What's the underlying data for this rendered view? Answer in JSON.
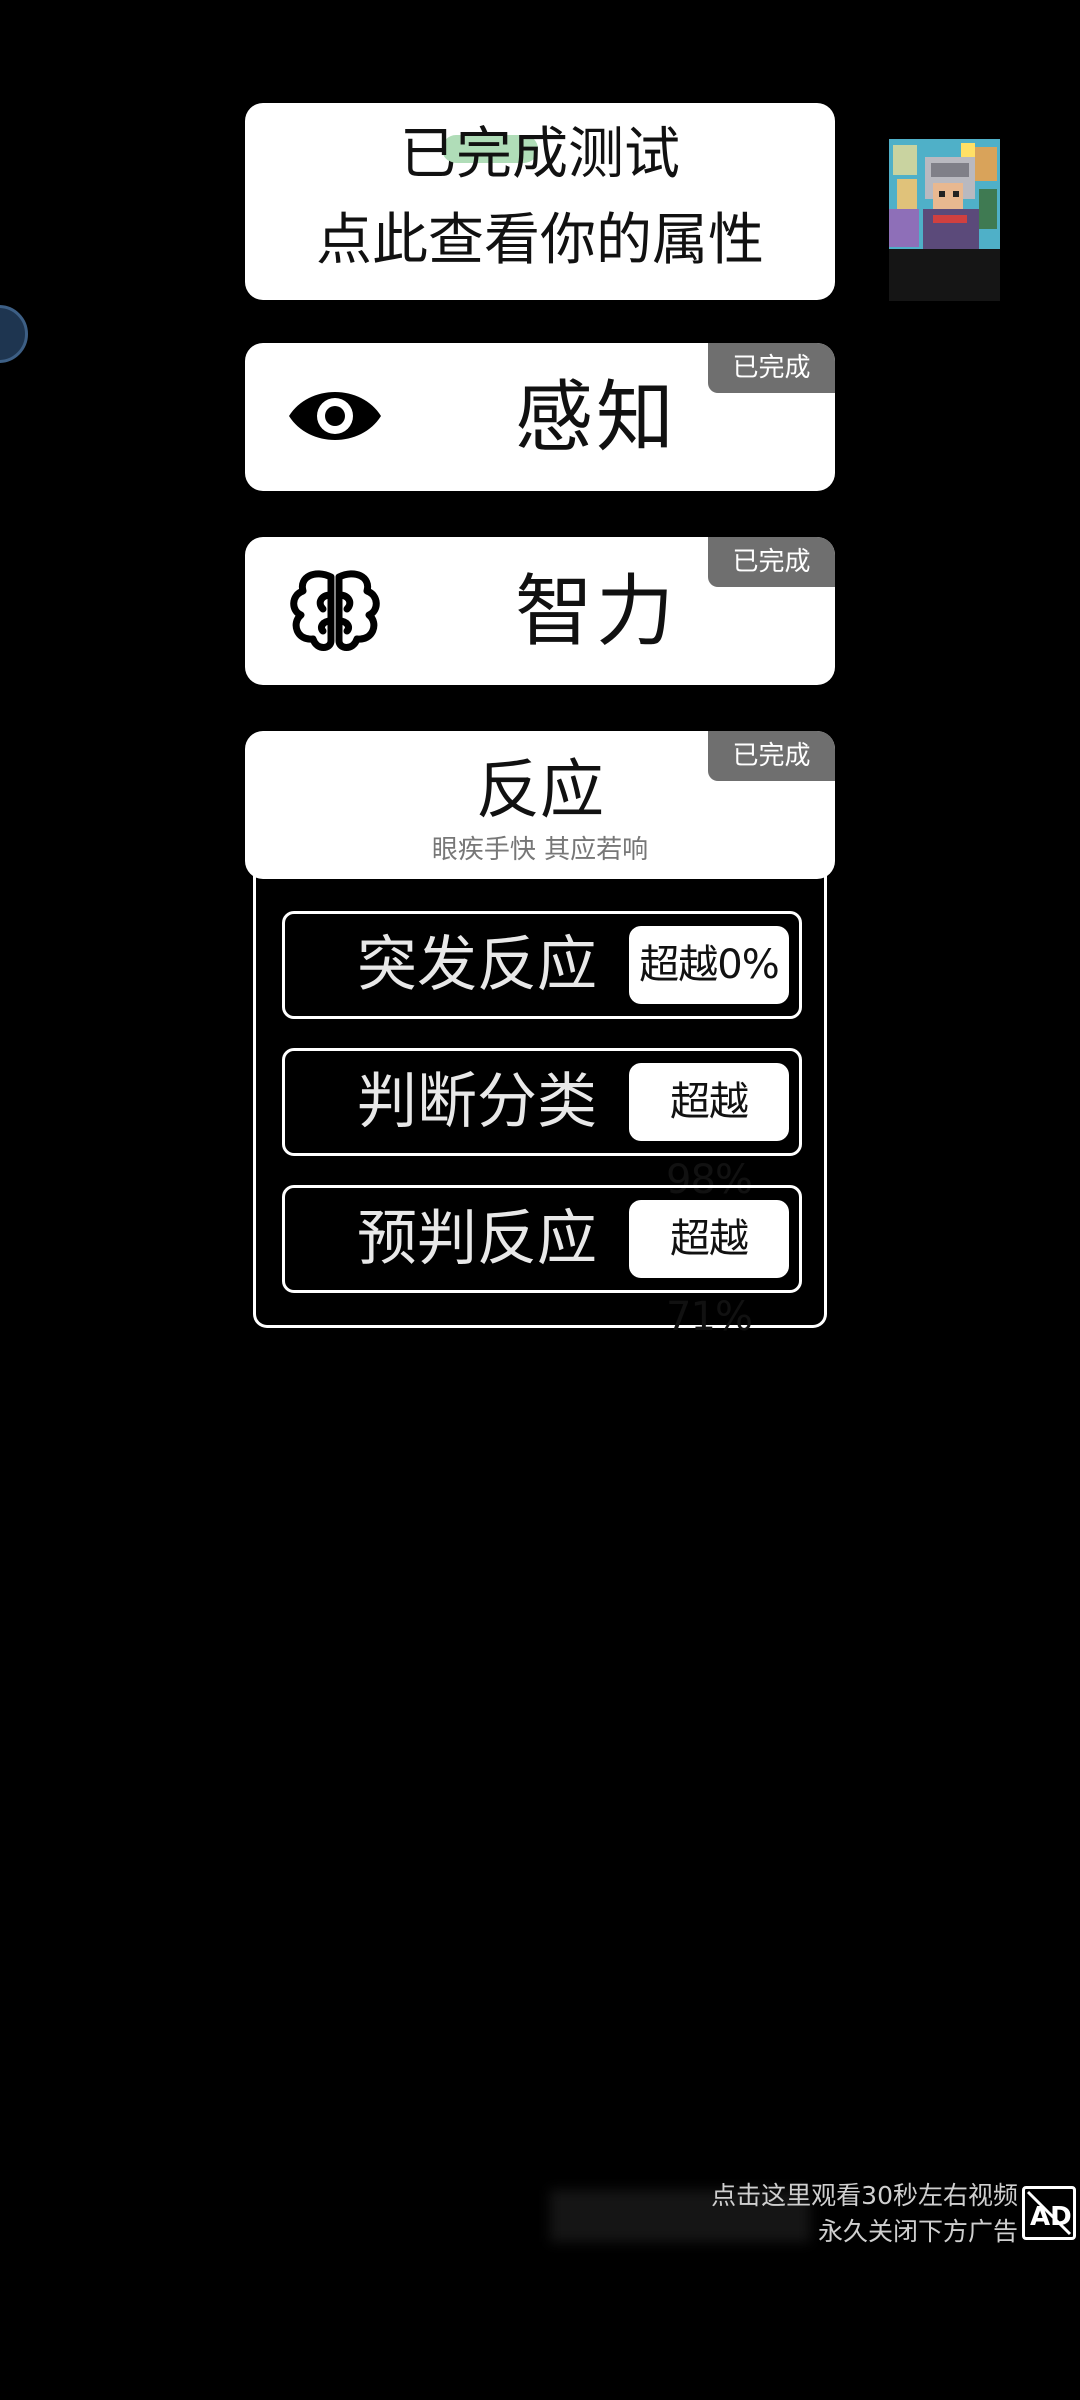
{
  "summary": {
    "line1": "已完成测试",
    "line2": "点此查看你的属性"
  },
  "attributes": [
    {
      "title": "感知",
      "badge": "已完成",
      "icon": "eye-icon"
    },
    {
      "title": "智力",
      "badge": "已完成",
      "icon": "brain-icon"
    },
    {
      "title": "反应",
      "badge": "已完成",
      "subtitle": "眼疾手快 其应若响"
    }
  ],
  "reaction_tests": [
    {
      "label": "突发反应",
      "score": "超越0%"
    },
    {
      "label": "判断分类",
      "score": "超越98%"
    },
    {
      "label": "预判反应",
      "score": "超越71%"
    }
  ],
  "ad": {
    "line1": "点击这里观看30秒左右视频",
    "line2": "永久关闭下方广告",
    "icon": "no-ad-icon"
  },
  "colors": {
    "background": "#000000",
    "card": "#ffffff",
    "badge": "#6f6f6f"
  }
}
